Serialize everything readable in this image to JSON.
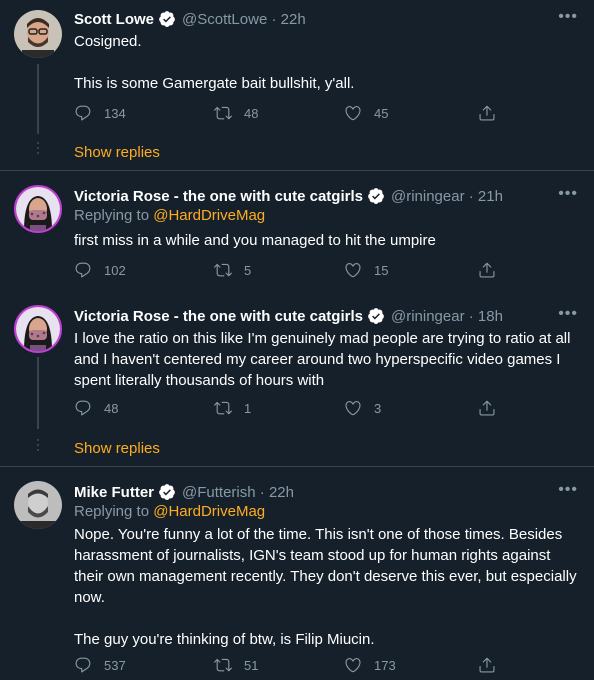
{
  "tweets": [
    {
      "name": "Scott Lowe",
      "handle": "@ScottLowe",
      "time": "· 22h",
      "reply_prefix": "",
      "reply_to": "",
      "body_lines": [
        "Cosigned.",
        "",
        "This is some Gamergate bait bullshit, y'all."
      ],
      "replies": "134",
      "retweets": "48",
      "likes": "45"
    },
    {
      "name": "Victoria Rose - the one with cute catgirls",
      "handle": "@riningear",
      "time": "· 21h",
      "reply_prefix": "Replying to",
      "reply_to": "@HardDriveMag",
      "body_lines": [
        "first miss in a while and you managed to hit the umpire"
      ],
      "replies": "102",
      "retweets": "5",
      "likes": "15"
    },
    {
      "name": "Victoria Rose - the one with cute catgirls",
      "handle": "@riningear",
      "time": "· 18h",
      "reply_prefix": "",
      "reply_to": "",
      "body_lines": [
        "I love the ratio on this like I'm genuinely mad people are trying to ratio at all",
        "and I haven't centered my career around two hyperspecific video games I",
        "spent literally thousands of hours with"
      ],
      "replies": "48",
      "retweets": "1",
      "likes": "3"
    },
    {
      "name": "Mike Futter",
      "handle": "@Futterish",
      "time": "· 22h",
      "reply_prefix": "Replying to",
      "reply_to": "@HardDriveMag",
      "body_lines": [
        "Nope. You're funny a lot of the time. This isn't one of those times. Besides",
        "harassment of journalists, IGN's team stood up for human rights against",
        "their own management recently. They don't deserve this ever, but especially",
        "now.",
        "",
        "The guy you're thinking of btw, is Filip Miucin."
      ],
      "replies": "537",
      "retweets": "51",
      "likes": "173"
    }
  ],
  "show_replies_label": "Show replies",
  "more_label": "•••",
  "colors": {
    "background": "#15202b",
    "secondary_text": "#8899a6",
    "accent": "#ffad1f",
    "verified": "#ffffff",
    "divider": "#38444d"
  }
}
